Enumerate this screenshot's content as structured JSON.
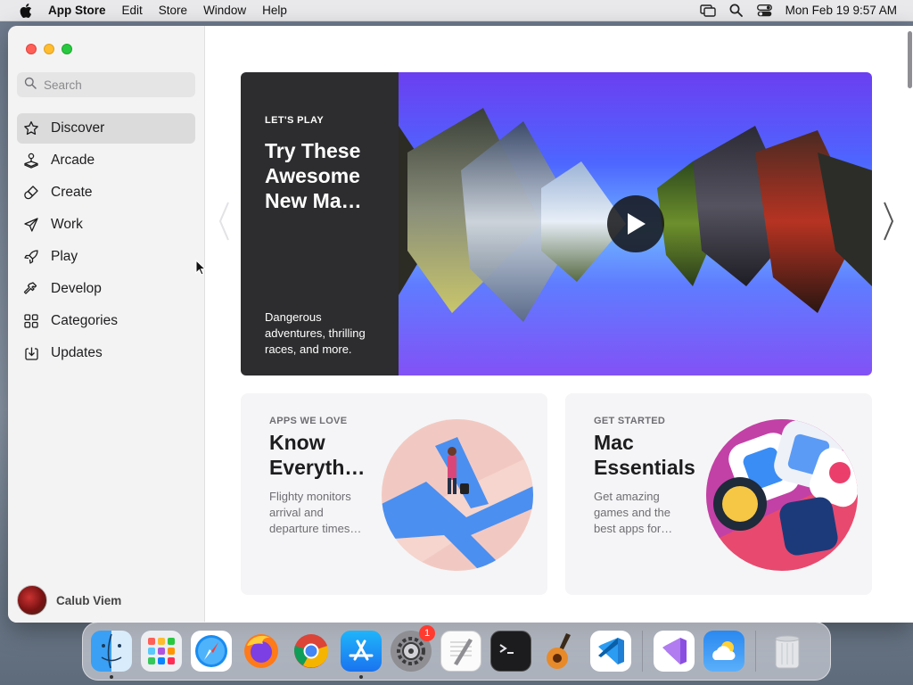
{
  "menubar": {
    "app_name": "App Store",
    "menus": [
      "Edit",
      "Store",
      "Window",
      "Help"
    ],
    "clock": "Mon Feb 19  9:57 AM"
  },
  "sidebar": {
    "search_placeholder": "Search",
    "items": [
      {
        "label": "Discover",
        "icon": "star-icon",
        "active": true
      },
      {
        "label": "Arcade",
        "icon": "joystick-icon"
      },
      {
        "label": "Create",
        "icon": "brush-icon"
      },
      {
        "label": "Work",
        "icon": "paper-plane-icon"
      },
      {
        "label": "Play",
        "icon": "rocket-icon"
      },
      {
        "label": "Develop",
        "icon": "hammer-icon"
      },
      {
        "label": "Categories",
        "icon": "grid-icon"
      },
      {
        "label": "Updates",
        "icon": "download-icon"
      }
    ],
    "user_name": "Calub Viem"
  },
  "hero": {
    "eyebrow": "LET'S PLAY",
    "title": "Try These Awesome New Ma…",
    "description": "Dangerous adventures, thrilling races, and more."
  },
  "cards": [
    {
      "eyebrow": "APPS WE LOVE",
      "title": "Know Everyth…",
      "description": "Flighty monitors arrival and departure times…"
    },
    {
      "eyebrow": "GET STARTED",
      "title": "Mac Essentials",
      "description": "Get amazing games and the best apps for…"
    }
  ],
  "dock": {
    "apps": [
      "Finder",
      "Launchpad",
      "Safari",
      "Firefox",
      "Chrome",
      "App Store",
      "System Settings",
      "TextEdit",
      "Terminal",
      "GarageBand",
      "Visual Studio Code",
      "Visual Studio",
      "Weather",
      "Trash"
    ],
    "settings_badge": "1"
  },
  "colors": {
    "accent_blue": "#0a84ff",
    "hero_dark": "#2d2d2f",
    "hero_purple": "#6b3ff0"
  }
}
